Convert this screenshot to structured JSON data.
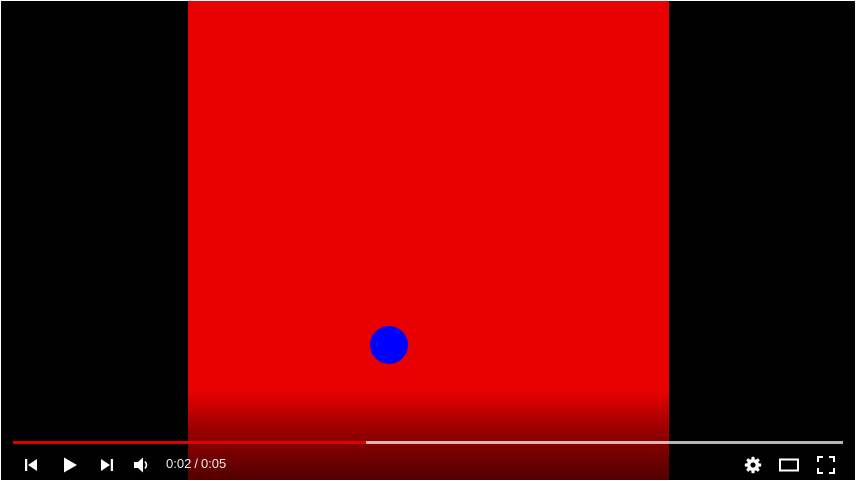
{
  "colors": {
    "background": "#000000",
    "video_frame": "#e90000",
    "ball": "#0000ff",
    "progress_played": "#e00000",
    "icon": "#ffffff"
  },
  "video": {
    "shapes": [
      "red-rectangle",
      "blue-circle"
    ]
  },
  "player": {
    "progress": {
      "played_fraction": 0.425,
      "loaded_fraction": 1.0
    },
    "time": {
      "current": "0:02",
      "separator": "/",
      "duration": "0:05"
    },
    "icons": {
      "previous": "previous-icon",
      "play": "play-icon",
      "next": "next-icon",
      "volume": "volume-icon",
      "settings": "gear-icon",
      "theater": "theater-mode-icon",
      "fullscreen": "fullscreen-icon"
    }
  }
}
